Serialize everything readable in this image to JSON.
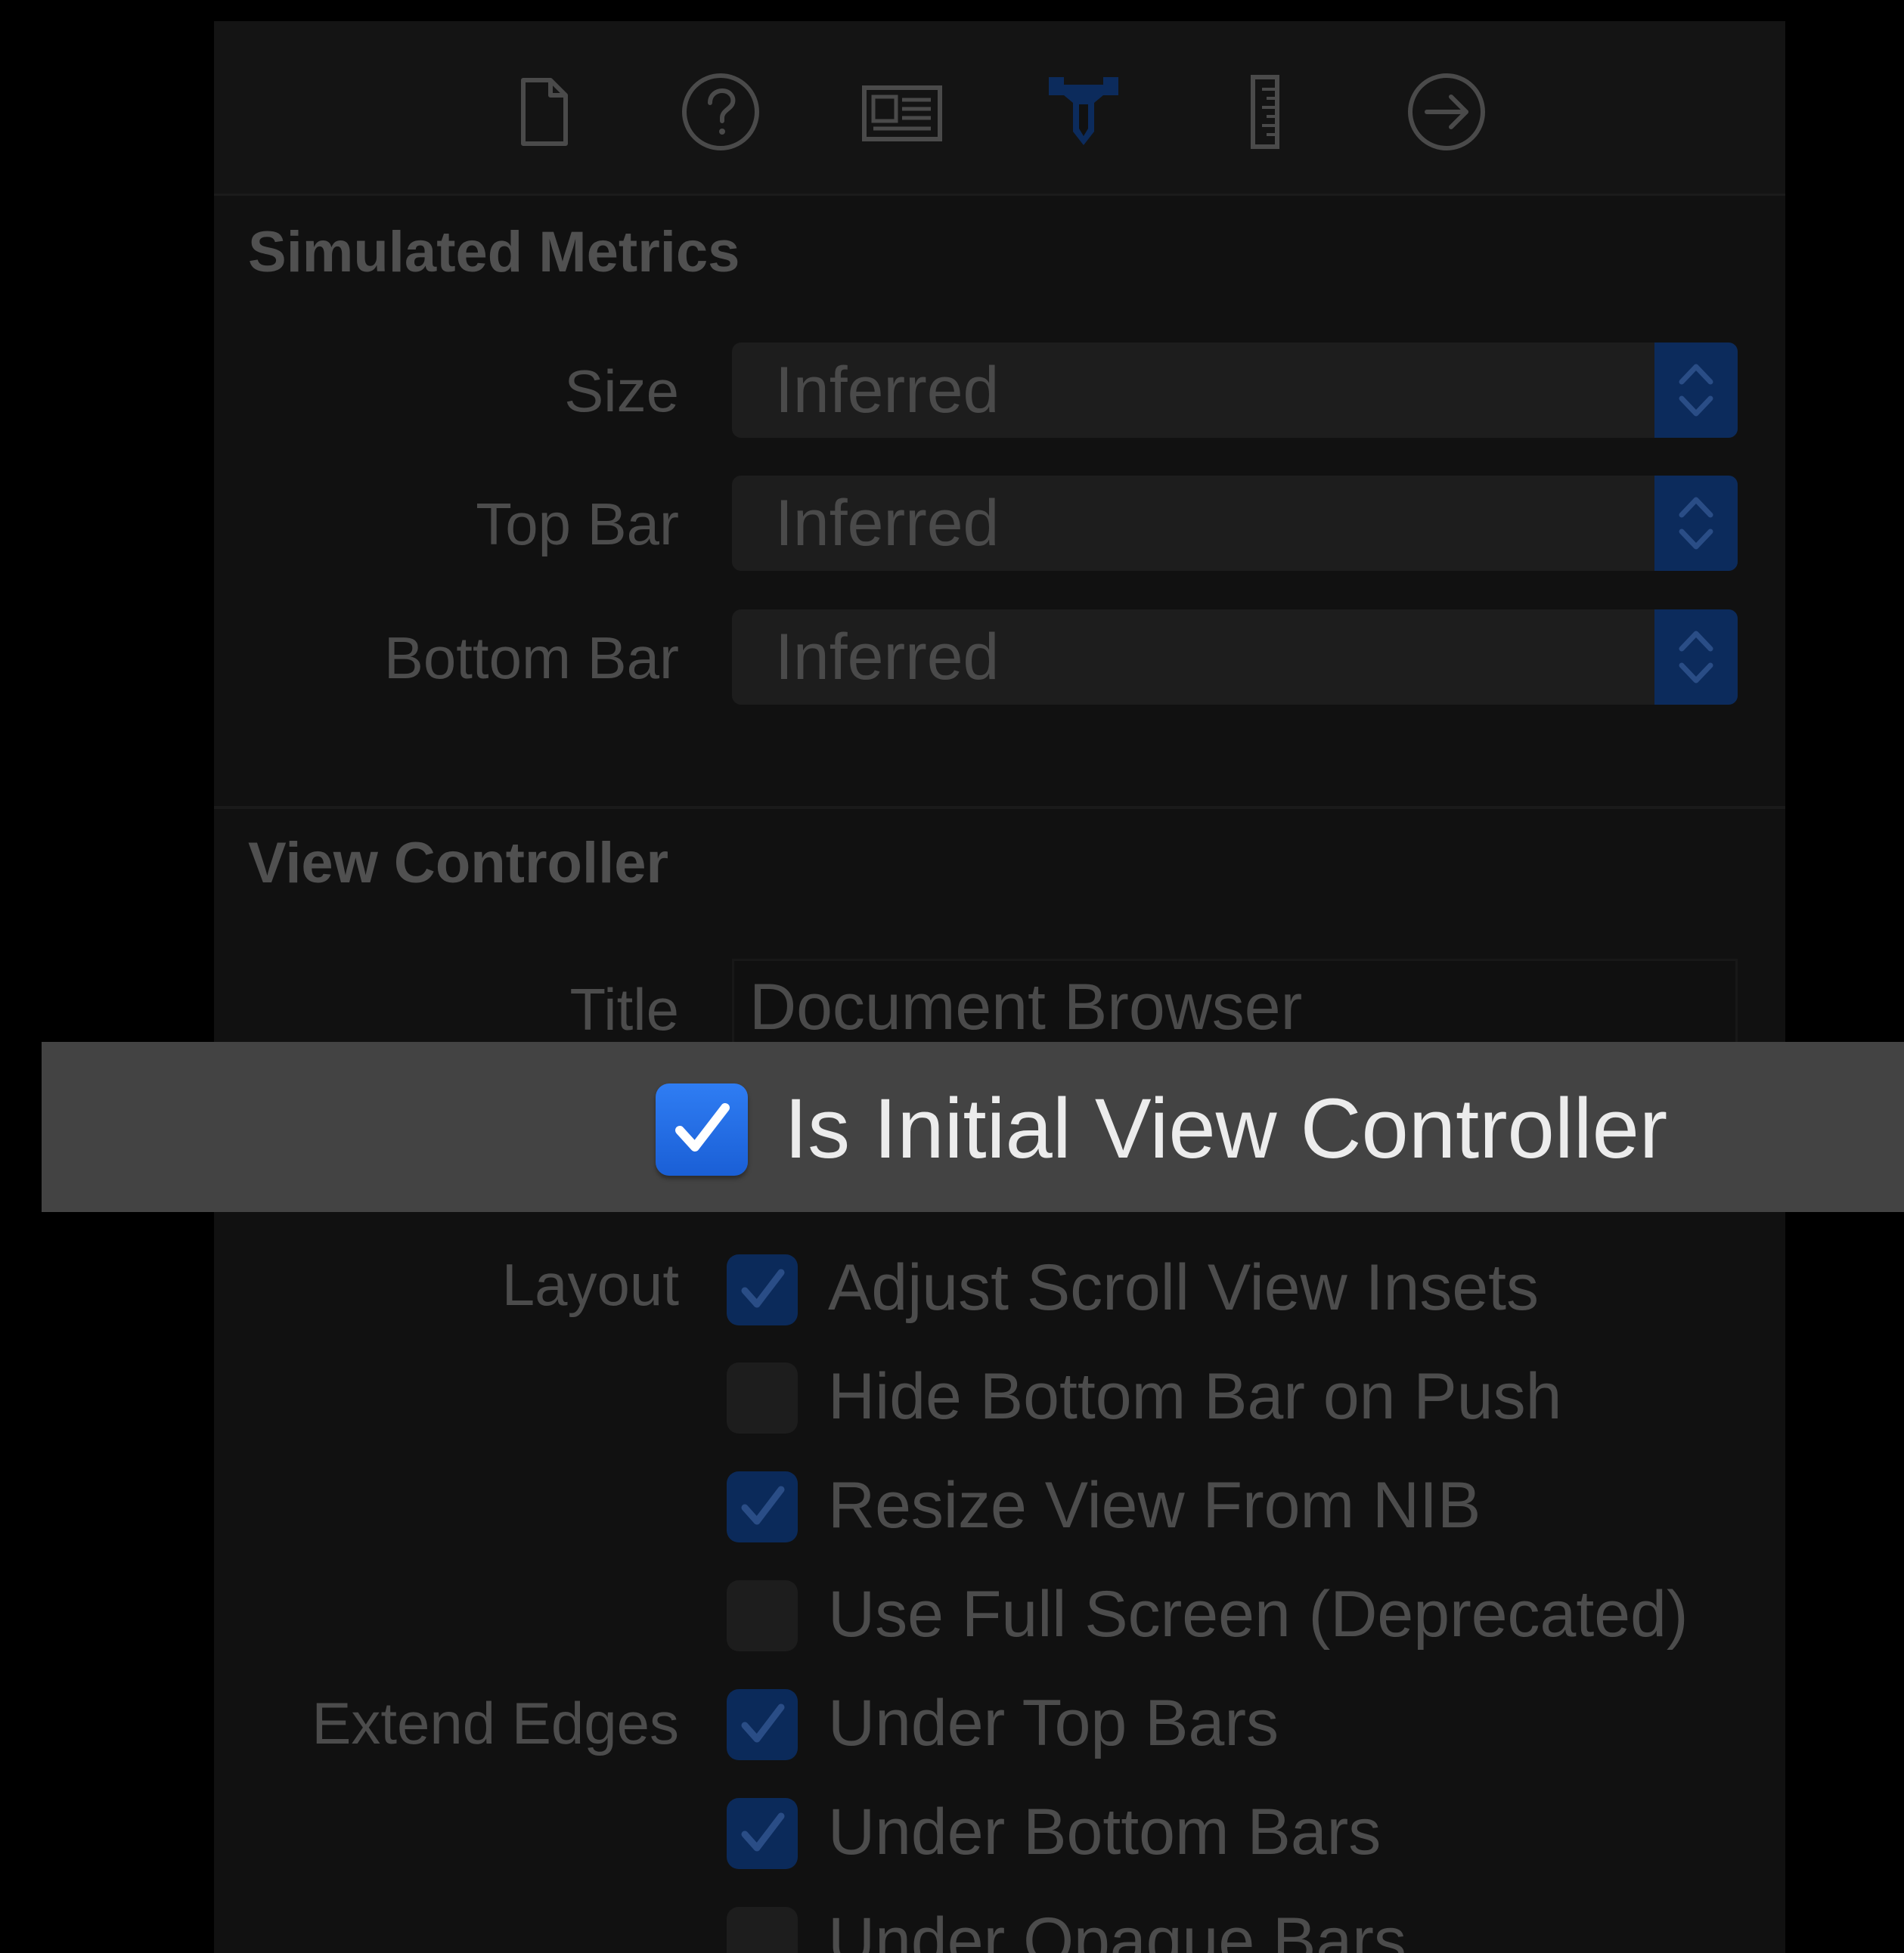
{
  "toolbar": {
    "icons": [
      "file-inspector-icon",
      "quick-help-icon",
      "identity-inspector-icon",
      "attributes-inspector-icon",
      "size-inspector-icon",
      "connections-inspector-icon"
    ],
    "active_icon": "attributes-inspector-icon",
    "accent_color": "#0c2b5c"
  },
  "simulated_metrics": {
    "title": "Simulated Metrics",
    "size": {
      "label": "Size",
      "value": "Inferred"
    },
    "top_bar": {
      "label": "Top Bar",
      "value": "Inferred"
    },
    "bottom_bar": {
      "label": "Bottom Bar",
      "value": "Inferred"
    }
  },
  "view_controller": {
    "title": "View Controller",
    "title_field": {
      "label": "Title",
      "value": "Document Browser"
    },
    "initial_vc": {
      "label": "Is Initial View Controller",
      "checked": true
    },
    "layout_label": "Layout",
    "layout_options": [
      {
        "label": "Adjust Scroll View Insets",
        "checked": true
      },
      {
        "label": "Hide Bottom Bar on Push",
        "checked": false
      },
      {
        "label": "Resize View From NIB",
        "checked": true
      },
      {
        "label": "Use Full Screen (Deprecated)",
        "checked": false
      }
    ],
    "extend_edges_label": "Extend Edges",
    "extend_edges_options": [
      {
        "label": "Under Top Bars",
        "checked": true
      },
      {
        "label": "Under Bottom Bars",
        "checked": true
      },
      {
        "label": "Under Opaque Bars",
        "checked": false
      }
    ]
  }
}
